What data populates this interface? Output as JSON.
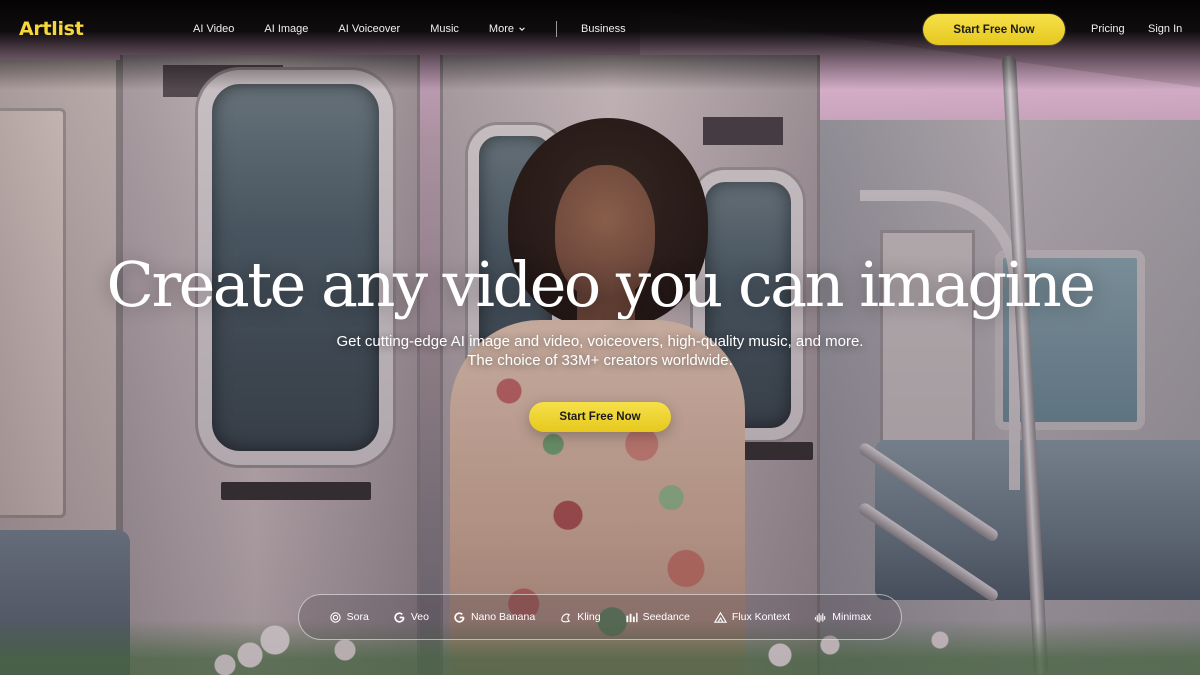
{
  "brand": {
    "logo": "Artlist",
    "accent": "#f5d73a"
  },
  "nav": {
    "links": [
      "AI Video",
      "AI Image",
      "AI Voiceover",
      "Music",
      "More",
      "Business"
    ],
    "cta": "Start Free Now",
    "pricing": "Pricing",
    "signin": "Sign In"
  },
  "hero": {
    "headline": "Create any video you can imagine",
    "subline1": "Get cutting-edge AI image and video, voiceovers, high-quality music, and more.",
    "subline2": "The choice of 33M+ creators worldwide.",
    "cta": "Start Free Now"
  },
  "models": [
    {
      "label": "Sora",
      "icon": "sora-icon"
    },
    {
      "label": "Veo",
      "icon": "google-icon"
    },
    {
      "label": "Nano Banana",
      "icon": "google-icon"
    },
    {
      "label": "Kling",
      "icon": "kling-icon"
    },
    {
      "label": "Seedance",
      "icon": "seedance-icon"
    },
    {
      "label": "Flux Kontext",
      "icon": "flux-icon"
    },
    {
      "label": "Minimax",
      "icon": "minimax-icon"
    }
  ]
}
